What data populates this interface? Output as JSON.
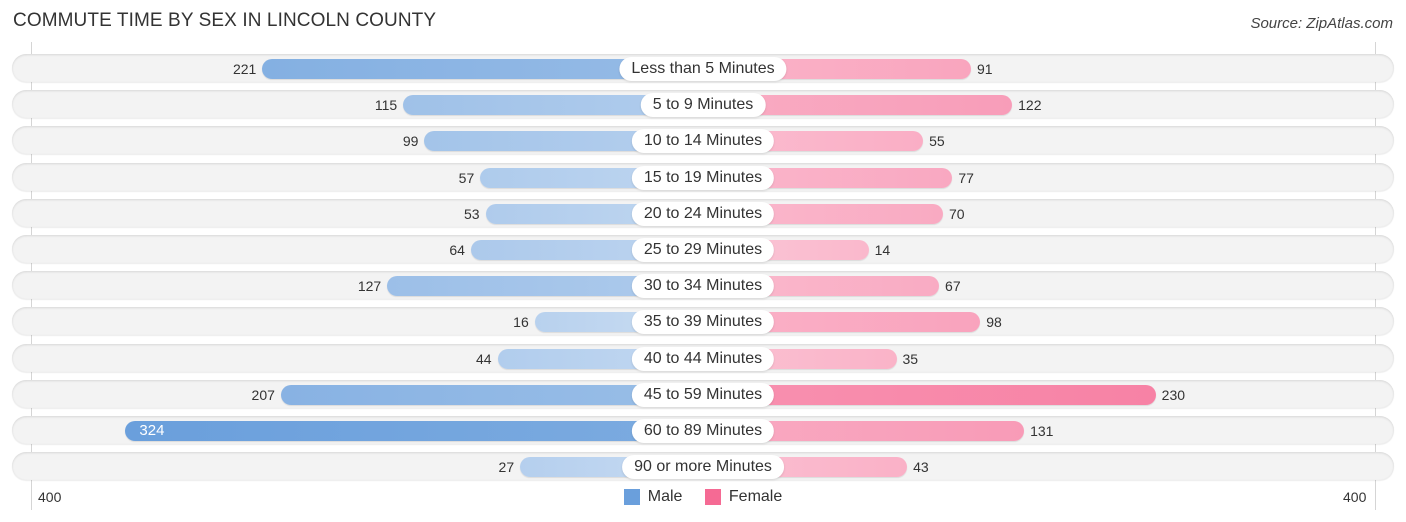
{
  "chart_data": {
    "type": "bar",
    "orientation": "horizontal-diverging",
    "title": "COMMUTE TIME BY SEX IN LINCOLN COUNTY",
    "source": "Source: ZipAtlas.com",
    "categories": [
      "Less than 5 Minutes",
      "5 to 9 Minutes",
      "10 to 14 Minutes",
      "15 to 19 Minutes",
      "20 to 24 Minutes",
      "25 to 29 Minutes",
      "30 to 34 Minutes",
      "35 to 39 Minutes",
      "40 to 44 Minutes",
      "45 to 59 Minutes",
      "60 to 89 Minutes",
      "90 or more Minutes"
    ],
    "series": [
      {
        "name": "Male",
        "color": "#6a9fdc",
        "values": [
          221,
          115,
          99,
          57,
          53,
          64,
          127,
          16,
          44,
          207,
          324,
          27
        ]
      },
      {
        "name": "Female",
        "color": "#f56a94",
        "values": [
          91,
          122,
          55,
          77,
          70,
          14,
          67,
          98,
          35,
          230,
          131,
          43
        ]
      }
    ],
    "xlim": [
      -400,
      400
    ],
    "tick_labels": {
      "left": "400",
      "right": "400"
    },
    "legend": {
      "position": "bottom-center",
      "entries": [
        "Male",
        "Female"
      ]
    },
    "grid": false
  }
}
